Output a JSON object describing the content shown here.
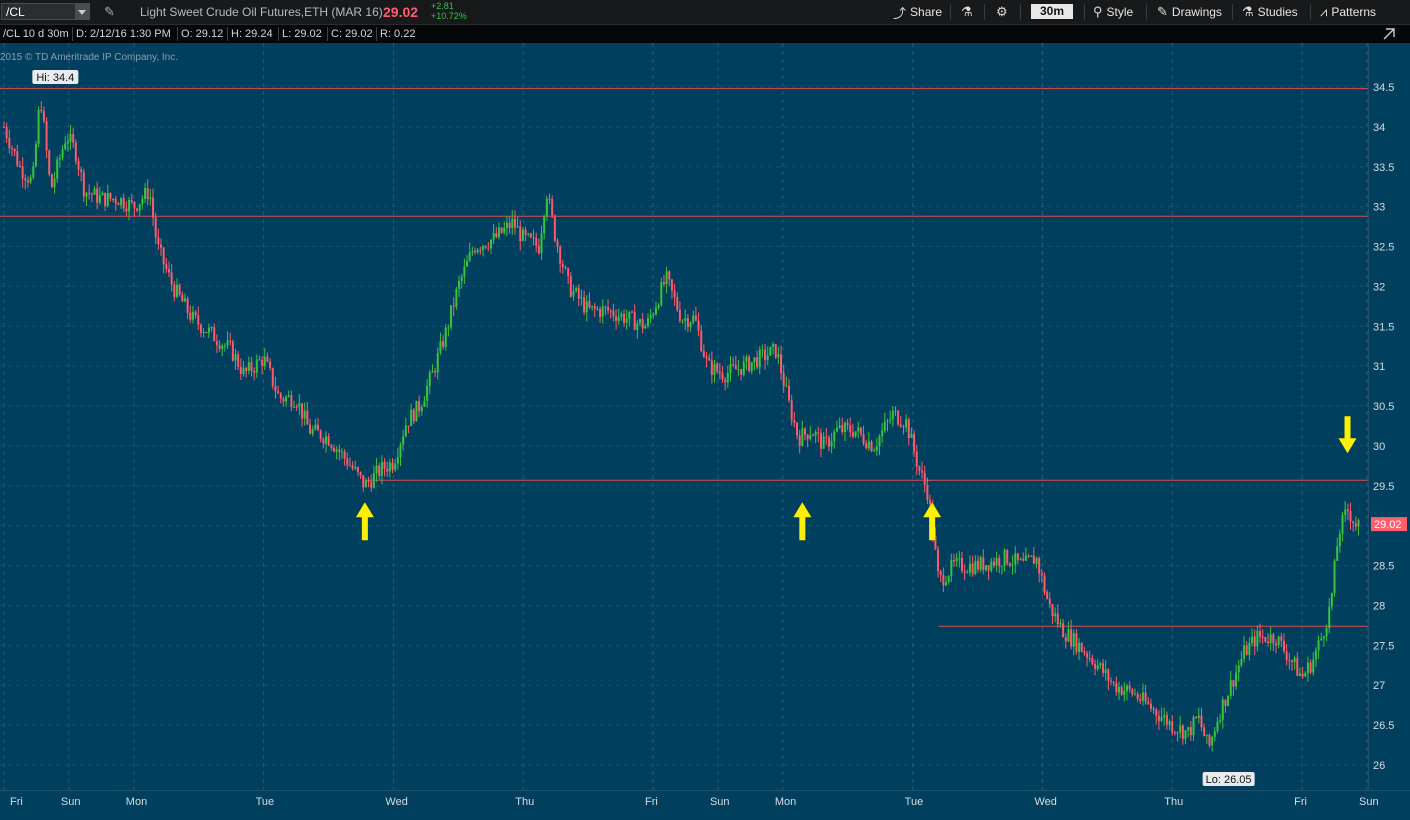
{
  "toolbar": {
    "symbol": "/CL",
    "description": "Light Sweet Crude Oil Futures,ETH (MAR 16)",
    "last_price": "29.02",
    "net_change": "+2.81",
    "pct_change": "+10.72%",
    "share_label": "Share",
    "timeframe": "30m",
    "style_label": "Style",
    "drawings_label": "Drawings",
    "studies_label": "Studies",
    "patterns_label": "Patterns"
  },
  "infobar": {
    "chart_id": "/CL 10 d 30m",
    "date": "D: 2/12/16 1:30 PM",
    "open": "O: 29.12",
    "high": "H: 29.24",
    "low": "L: 29.02",
    "close": "C: 29.02",
    "range": "R: 0.22"
  },
  "copyright": "2015 © TD Ameritrade IP Company, Inc.",
  "colors": {
    "background": "#003f5e",
    "up_candle": "#39c43d",
    "down_candle": "#ff5a6a",
    "price_line": "#e0494d",
    "arrow": "#ffef00",
    "grid": "#2a5b77"
  },
  "chart_data": {
    "type": "candlestick",
    "ylim": [
      25.75,
      35.0
    ],
    "y_ticks": [
      "34.5",
      "34",
      "33.5",
      "33",
      "32.5",
      "32",
      "31.5",
      "31",
      "30.5",
      "30",
      "29.5",
      "29",
      "28.5",
      "28",
      "27.5",
      "27",
      "26.5",
      "26"
    ],
    "x_ticks": [
      "Fri",
      "Sun",
      "Mon",
      "Tue",
      "Wed",
      "Thu",
      "Fri",
      "Sun",
      "Mon",
      "Tue",
      "Wed",
      "Thu",
      "Fri",
      "Sun"
    ],
    "x_tick_positions": [
      0.0,
      0.5,
      1.0,
      2.0,
      3.0,
      4.0,
      5.0,
      5.5,
      6.0,
      7.0,
      8.0,
      9.0,
      10.0,
      10.5
    ],
    "x_range": [
      0.0,
      10.5
    ],
    "path": [
      [
        0.0,
        34.0
      ],
      [
        0.12,
        33.5
      ],
      [
        0.22,
        33.3
      ],
      [
        0.28,
        34.4
      ],
      [
        0.36,
        33.2
      ],
      [
        0.48,
        33.9
      ],
      [
        0.55,
        33.7
      ],
      [
        0.62,
        33.2
      ],
      [
        0.75,
        33.1
      ],
      [
        0.88,
        33.1
      ],
      [
        1.0,
        33.0
      ],
      [
        1.12,
        33.2
      ],
      [
        1.18,
        32.5
      ],
      [
        1.3,
        32.0
      ],
      [
        1.45,
        31.6
      ],
      [
        1.6,
        31.4
      ],
      [
        1.75,
        31.2
      ],
      [
        1.85,
        30.9
      ],
      [
        2.0,
        31.1
      ],
      [
        2.12,
        30.6
      ],
      [
        2.25,
        30.6
      ],
      [
        2.35,
        30.2
      ],
      [
        2.5,
        30.1
      ],
      [
        2.65,
        29.8
      ],
      [
        2.78,
        29.5
      ],
      [
        2.9,
        29.7
      ],
      [
        3.0,
        29.8
      ],
      [
        3.1,
        30.3
      ],
      [
        3.2,
        30.5
      ],
      [
        3.3,
        30.9
      ],
      [
        3.4,
        31.4
      ],
      [
        3.5,
        32.0
      ],
      [
        3.62,
        32.5
      ],
      [
        3.78,
        32.6
      ],
      [
        3.92,
        32.8
      ],
      [
        4.0,
        32.6
      ],
      [
        4.12,
        32.5
      ],
      [
        4.18,
        33.2
      ],
      [
        4.25,
        32.6
      ],
      [
        4.35,
        32.0
      ],
      [
        4.5,
        31.7
      ],
      [
        4.65,
        31.7
      ],
      [
        4.8,
        31.6
      ],
      [
        4.95,
        31.5
      ],
      [
        5.0,
        31.7
      ],
      [
        5.1,
        32.1
      ],
      [
        5.22,
        31.6
      ],
      [
        5.32,
        31.6
      ],
      [
        5.42,
        31.0
      ],
      [
        5.55,
        30.9
      ],
      [
        5.7,
        31.0
      ],
      [
        5.82,
        31.1
      ],
      [
        5.95,
        31.2
      ],
      [
        6.05,
        30.5
      ],
      [
        6.12,
        30.1
      ],
      [
        6.22,
        30.2
      ],
      [
        6.32,
        30.0
      ],
      [
        6.42,
        30.2
      ],
      [
        6.55,
        30.2
      ],
      [
        6.7,
        30.0
      ],
      [
        6.85,
        30.4
      ],
      [
        6.95,
        30.3
      ],
      [
        7.05,
        29.7
      ],
      [
        7.12,
        29.4
      ],
      [
        7.2,
        28.3
      ],
      [
        7.32,
        28.5
      ],
      [
        7.5,
        28.5
      ],
      [
        7.72,
        28.6
      ],
      [
        7.85,
        28.5
      ],
      [
        7.95,
        28.6
      ],
      [
        8.05,
        28.0
      ],
      [
        8.15,
        27.7
      ],
      [
        8.28,
        27.5
      ],
      [
        8.4,
        27.3
      ],
      [
        8.55,
        27.0
      ],
      [
        8.7,
        26.9
      ],
      [
        8.85,
        26.7
      ],
      [
        9.0,
        26.5
      ],
      [
        9.12,
        26.4
      ],
      [
        9.2,
        26.6
      ],
      [
        9.28,
        26.2
      ],
      [
        9.35,
        26.6
      ],
      [
        9.45,
        27.0
      ],
      [
        9.55,
        27.4
      ],
      [
        9.65,
        27.6
      ],
      [
        9.8,
        27.6
      ],
      [
        9.92,
        27.3
      ],
      [
        10.0,
        27.1
      ],
      [
        10.08,
        27.3
      ],
      [
        10.15,
        27.6
      ],
      [
        10.22,
        28.0
      ],
      [
        10.28,
        28.9
      ],
      [
        10.35,
        29.2
      ],
      [
        10.42,
        29.0
      ],
      [
        10.45,
        29.02
      ]
    ],
    "horizontal_lines": [
      34.48,
      32.88,
      29.57,
      27.74
    ],
    "hi_label": "Hi: 34.4",
    "lo_label": "Lo: 26.05",
    "last_label": "29.02",
    "arrows": [
      {
        "x": 2.78,
        "dir": "up"
      },
      {
        "x": 6.15,
        "dir": "up"
      },
      {
        "x": 7.15,
        "dir": "up"
      },
      {
        "x": 10.35,
        "dir": "down"
      }
    ]
  }
}
